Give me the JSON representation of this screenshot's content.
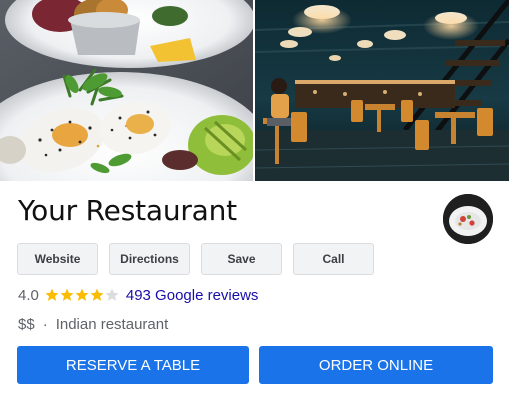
{
  "place": {
    "name": "Your Restaurant",
    "rating": "4.0",
    "rating_value": 4.0,
    "rating_max": 5,
    "reviews_label": "493 Google reviews",
    "price": "$$",
    "separator": "·",
    "category": "Indian restaurant"
  },
  "actions": {
    "website": "Website",
    "directions": "Directions",
    "save": "Save",
    "call": "Call"
  },
  "cta": {
    "reserve": "RESERVE A TABLE",
    "order": "ORDER ONLINE"
  },
  "colors": {
    "primary": "#1a73e8",
    "star_filled": "#fbbc04",
    "star_empty": "#dadce0",
    "link": "#1a0dab",
    "muted_text": "#5f6368"
  },
  "icons": {
    "star": "star-icon",
    "avatar": "restaurant-avatar"
  }
}
